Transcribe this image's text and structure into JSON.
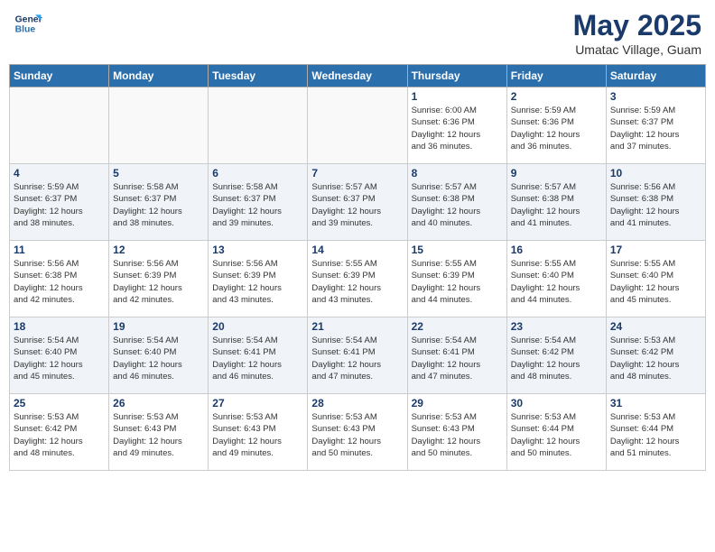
{
  "header": {
    "logo_line1": "General",
    "logo_line2": "Blue",
    "month_year": "May 2025",
    "location": "Umatac Village, Guam"
  },
  "days_of_week": [
    "Sunday",
    "Monday",
    "Tuesday",
    "Wednesday",
    "Thursday",
    "Friday",
    "Saturday"
  ],
  "weeks": [
    [
      {
        "day": "",
        "info": ""
      },
      {
        "day": "",
        "info": ""
      },
      {
        "day": "",
        "info": ""
      },
      {
        "day": "",
        "info": ""
      },
      {
        "day": "1",
        "info": "Sunrise: 6:00 AM\nSunset: 6:36 PM\nDaylight: 12 hours\nand 36 minutes."
      },
      {
        "day": "2",
        "info": "Sunrise: 5:59 AM\nSunset: 6:36 PM\nDaylight: 12 hours\nand 36 minutes."
      },
      {
        "day": "3",
        "info": "Sunrise: 5:59 AM\nSunset: 6:37 PM\nDaylight: 12 hours\nand 37 minutes."
      }
    ],
    [
      {
        "day": "4",
        "info": "Sunrise: 5:59 AM\nSunset: 6:37 PM\nDaylight: 12 hours\nand 38 minutes."
      },
      {
        "day": "5",
        "info": "Sunrise: 5:58 AM\nSunset: 6:37 PM\nDaylight: 12 hours\nand 38 minutes."
      },
      {
        "day": "6",
        "info": "Sunrise: 5:58 AM\nSunset: 6:37 PM\nDaylight: 12 hours\nand 39 minutes."
      },
      {
        "day": "7",
        "info": "Sunrise: 5:57 AM\nSunset: 6:37 PM\nDaylight: 12 hours\nand 39 minutes."
      },
      {
        "day": "8",
        "info": "Sunrise: 5:57 AM\nSunset: 6:38 PM\nDaylight: 12 hours\nand 40 minutes."
      },
      {
        "day": "9",
        "info": "Sunrise: 5:57 AM\nSunset: 6:38 PM\nDaylight: 12 hours\nand 41 minutes."
      },
      {
        "day": "10",
        "info": "Sunrise: 5:56 AM\nSunset: 6:38 PM\nDaylight: 12 hours\nand 41 minutes."
      }
    ],
    [
      {
        "day": "11",
        "info": "Sunrise: 5:56 AM\nSunset: 6:38 PM\nDaylight: 12 hours\nand 42 minutes."
      },
      {
        "day": "12",
        "info": "Sunrise: 5:56 AM\nSunset: 6:39 PM\nDaylight: 12 hours\nand 42 minutes."
      },
      {
        "day": "13",
        "info": "Sunrise: 5:56 AM\nSunset: 6:39 PM\nDaylight: 12 hours\nand 43 minutes."
      },
      {
        "day": "14",
        "info": "Sunrise: 5:55 AM\nSunset: 6:39 PM\nDaylight: 12 hours\nand 43 minutes."
      },
      {
        "day": "15",
        "info": "Sunrise: 5:55 AM\nSunset: 6:39 PM\nDaylight: 12 hours\nand 44 minutes."
      },
      {
        "day": "16",
        "info": "Sunrise: 5:55 AM\nSunset: 6:40 PM\nDaylight: 12 hours\nand 44 minutes."
      },
      {
        "day": "17",
        "info": "Sunrise: 5:55 AM\nSunset: 6:40 PM\nDaylight: 12 hours\nand 45 minutes."
      }
    ],
    [
      {
        "day": "18",
        "info": "Sunrise: 5:54 AM\nSunset: 6:40 PM\nDaylight: 12 hours\nand 45 minutes."
      },
      {
        "day": "19",
        "info": "Sunrise: 5:54 AM\nSunset: 6:40 PM\nDaylight: 12 hours\nand 46 minutes."
      },
      {
        "day": "20",
        "info": "Sunrise: 5:54 AM\nSunset: 6:41 PM\nDaylight: 12 hours\nand 46 minutes."
      },
      {
        "day": "21",
        "info": "Sunrise: 5:54 AM\nSunset: 6:41 PM\nDaylight: 12 hours\nand 47 minutes."
      },
      {
        "day": "22",
        "info": "Sunrise: 5:54 AM\nSunset: 6:41 PM\nDaylight: 12 hours\nand 47 minutes."
      },
      {
        "day": "23",
        "info": "Sunrise: 5:54 AM\nSunset: 6:42 PM\nDaylight: 12 hours\nand 48 minutes."
      },
      {
        "day": "24",
        "info": "Sunrise: 5:53 AM\nSunset: 6:42 PM\nDaylight: 12 hours\nand 48 minutes."
      }
    ],
    [
      {
        "day": "25",
        "info": "Sunrise: 5:53 AM\nSunset: 6:42 PM\nDaylight: 12 hours\nand 48 minutes."
      },
      {
        "day": "26",
        "info": "Sunrise: 5:53 AM\nSunset: 6:43 PM\nDaylight: 12 hours\nand 49 minutes."
      },
      {
        "day": "27",
        "info": "Sunrise: 5:53 AM\nSunset: 6:43 PM\nDaylight: 12 hours\nand 49 minutes."
      },
      {
        "day": "28",
        "info": "Sunrise: 5:53 AM\nSunset: 6:43 PM\nDaylight: 12 hours\nand 50 minutes."
      },
      {
        "day": "29",
        "info": "Sunrise: 5:53 AM\nSunset: 6:43 PM\nDaylight: 12 hours\nand 50 minutes."
      },
      {
        "day": "30",
        "info": "Sunrise: 5:53 AM\nSunset: 6:44 PM\nDaylight: 12 hours\nand 50 minutes."
      },
      {
        "day": "31",
        "info": "Sunrise: 5:53 AM\nSunset: 6:44 PM\nDaylight: 12 hours\nand 51 minutes."
      }
    ]
  ]
}
